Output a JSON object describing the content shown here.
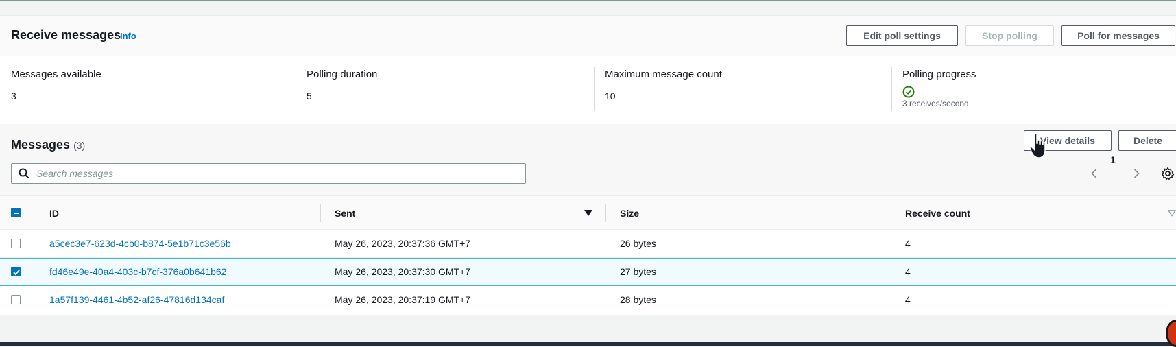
{
  "panel": {
    "title": "Receive messages",
    "info_label": "Info",
    "buttons": {
      "edit_poll_settings": "Edit poll settings",
      "stop_polling": "Stop polling",
      "poll_for_messages": "Poll for messages"
    }
  },
  "stats": {
    "messages_available": {
      "label": "Messages available",
      "value": "3"
    },
    "polling_duration": {
      "label": "Polling duration",
      "value": "5"
    },
    "maximum_message_count": {
      "label": "Maximum message count",
      "value": "10"
    },
    "polling_progress": {
      "label": "Polling progress",
      "icon": "check-circle-icon",
      "text": "3 receives/second"
    }
  },
  "messages": {
    "title": "Messages",
    "count": "(3)",
    "view_details_label": "View details",
    "delete_label": "Delete",
    "search_placeholder": "Search messages",
    "page_number": "1"
  },
  "table": {
    "columns": {
      "id": "ID",
      "sent": "Sent",
      "size": "Size",
      "receive_count": "Receive count"
    },
    "rows": [
      {
        "id": "a5cec3e7-623d-4cb0-b874-5e1b71c3e56b",
        "sent": "May 26, 2023, 20:37:36 GMT+7",
        "size": "26 bytes",
        "receive_count": "4",
        "selected": false
      },
      {
        "id": "fd46e49e-40a4-403c-b7cf-376a0b641b62",
        "sent": "May 26, 2023, 20:37:30 GMT+7",
        "size": "27 bytes",
        "receive_count": "4",
        "selected": true
      },
      {
        "id": "1a57f139-4461-4b52-af26-47816d134caf",
        "sent": "May 26, 2023, 20:37:19 GMT+7",
        "size": "28 bytes",
        "receive_count": "4",
        "selected": false
      }
    ]
  },
  "colors": {
    "link": "#0073bb",
    "success": "#1d8102",
    "selected_row_border": "#44b9d6"
  }
}
